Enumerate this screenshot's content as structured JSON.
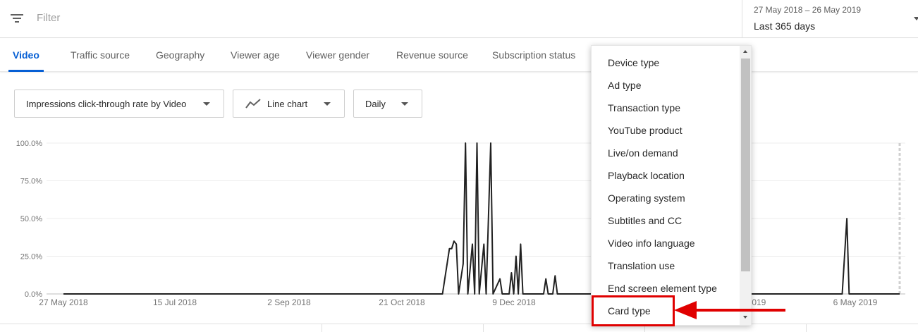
{
  "filter": {
    "placeholder": "Filter"
  },
  "date": {
    "range": "27 May 2018 – 26 May 2019",
    "preset": "Last 365 days"
  },
  "tabs": [
    {
      "label": "Video",
      "active": true
    },
    {
      "label": "Traffic source"
    },
    {
      "label": "Geography"
    },
    {
      "label": "Viewer age"
    },
    {
      "label": "Viewer gender"
    },
    {
      "label": "Revenue source"
    },
    {
      "label": "Subscription status"
    }
  ],
  "controls": {
    "metric": "Impressions click-through rate by Video",
    "chart_type": "Line chart",
    "granularity": "Daily"
  },
  "menu": {
    "items": [
      "Device type",
      "Ad type",
      "Transaction type",
      "YouTube product",
      "Live/on demand",
      "Playback location",
      "Operating system",
      "Subtitles and CC",
      "Video info language",
      "Translation use",
      "End screen element type",
      "Card type"
    ],
    "highlighted": "Card type"
  },
  "colors": {
    "accent": "#065fd4",
    "line": "#212121",
    "highlight": "#e00000"
  },
  "chart_data": {
    "type": "line",
    "ylim": [
      0,
      100
    ],
    "y_ticks": [
      "0.0%",
      "25.0%",
      "50.0%",
      "75.0%",
      "100.0%"
    ],
    "x_ticks": [
      "27 May 2018",
      "15 Jul 2018",
      "2 Sep 2018",
      "21 Oct 2018",
      "9 Dec 2018",
      "2019",
      "6 May 2019"
    ],
    "grid": true,
    "series": [
      {
        "values": [
          [
            "2018-05-27",
            0
          ],
          [
            "2018-11-08",
            0
          ],
          [
            "2018-11-11",
            30
          ],
          [
            "2018-11-12",
            30
          ],
          [
            "2018-11-13",
            35
          ],
          [
            "2018-11-14",
            33
          ],
          [
            "2018-11-15",
            0
          ],
          [
            "2018-11-17",
            20
          ],
          [
            "2018-11-18",
            100
          ],
          [
            "2018-11-19",
            0
          ],
          [
            "2018-11-21",
            33
          ],
          [
            "2018-11-22",
            0
          ],
          [
            "2018-11-23",
            100
          ],
          [
            "2018-11-24",
            0
          ],
          [
            "2018-11-26",
            33
          ],
          [
            "2018-11-27",
            0
          ],
          [
            "2018-11-29",
            100
          ],
          [
            "2018-11-30",
            0
          ],
          [
            "2018-12-03",
            10
          ],
          [
            "2018-12-04",
            0
          ],
          [
            "2018-12-07",
            0
          ],
          [
            "2018-12-08",
            14
          ],
          [
            "2018-12-09",
            0
          ],
          [
            "2018-12-10",
            25
          ],
          [
            "2018-12-11",
            0
          ],
          [
            "2018-12-12",
            33
          ],
          [
            "2018-12-13",
            0
          ],
          [
            "2018-12-22",
            0
          ],
          [
            "2018-12-23",
            10
          ],
          [
            "2018-12-24",
            0
          ],
          [
            "2018-12-26",
            0
          ],
          [
            "2018-12-27",
            12
          ],
          [
            "2018-12-28",
            0
          ],
          [
            "2019-03-10",
            0
          ],
          [
            "2019-03-11",
            25
          ],
          [
            "2019-03-12",
            0
          ],
          [
            "2019-03-14",
            33
          ],
          [
            "2019-03-15",
            0
          ],
          [
            "2019-03-16",
            100
          ],
          [
            "2019-03-17",
            0
          ],
          [
            "2019-05-01",
            0
          ],
          [
            "2019-05-03",
            50
          ],
          [
            "2019-05-04",
            0
          ],
          [
            "2019-05-26",
            0
          ]
        ]
      }
    ]
  }
}
